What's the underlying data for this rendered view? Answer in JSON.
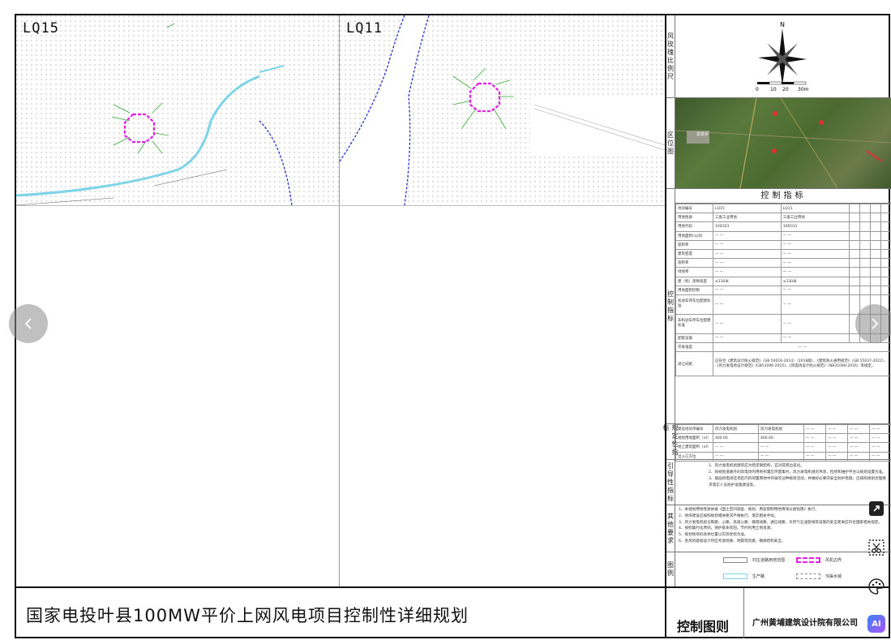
{
  "panels": {
    "left_label": "LQ15",
    "right_label": "LQ11"
  },
  "right_column": {
    "sections": {
      "compass": "风玫瑰比例尺",
      "location": "区位图",
      "control": "控制指标",
      "guide": "引导性指标",
      "other": "其他要求",
      "legend": "图例"
    },
    "scale_labels": [
      "0",
      "10",
      "20",
      "30m"
    ],
    "north": "N"
  },
  "control_table": {
    "title": "控制指标",
    "header": [
      "地块编号",
      "LQ15",
      "LQ11"
    ],
    "rows": [
      [
        "用地性质",
        "三类工业用地",
        "三类工业用地"
      ],
      [
        "用地代码",
        "100103",
        "100103"
      ],
      [
        "用地面积(公顷)",
        "— —",
        "— —"
      ],
      [
        "容积率",
        "— —",
        "— —"
      ],
      [
        "建筑密度",
        "— —",
        "— —"
      ],
      [
        "容积率",
        "— —",
        "— —"
      ],
      [
        "绿地率",
        "— —",
        "— —"
      ],
      [
        "建（构）筑物高度",
        "≤130米",
        "≤130米"
      ],
      [
        "用地面积控制",
        "— —",
        "— —"
      ],
      [
        "机动车停车位配建标准",
        "— —",
        "— —"
      ],
      [
        "非机动车停车位配建标准",
        "— —",
        "— —"
      ],
      [
        "配套设施",
        "— —",
        "— —"
      ],
      [
        "开发强度",
        "— —",
        ""
      ],
      [
        "退让间距",
        "应符合《建筑设计防火规范》（GB 50016-2014）（2018版）、《建筑防火通用规范》（GB 55037-2022）、《风力发电场设计规范》(GB51096-2015)、《风电场设计防火规范》（NB31089-2016）等规定。",
        ""
      ]
    ],
    "rows2": [
      [
        "建设地块单编号",
        "风力发电机组",
        "风力发电机组",
        "— —",
        "— —",
        "— —",
        "— —"
      ],
      [
        "规划用地面积（㎡）",
        "400.00",
        "400.00",
        "— —",
        "— —",
        "— —",
        "— —"
      ],
      [
        "地上建筑面积（㎡）",
        "— —",
        "— —",
        "— —",
        "— —",
        "— —",
        "— —"
      ],
      [
        "出入口方位",
        "— —",
        "— —",
        "— —",
        "— —",
        "— —",
        "— —"
      ]
    ]
  },
  "guide_text": [
    "1、风力发电机组建筑应为稳定钢结构，宜对其周边美化。",
    "2、除规划道路外的风电场内用地布置应尽量集约，风力发电机组的吊装、检修和维护平台以规划设置为准。",
    "3、鼓励风电场在场区内的闲置用地中开展农业种植等活动，并做好必要的安全防护措施；应按照规划合理要求落实人员防护设施建设等。"
  ],
  "other_text": [
    "1、本规划用地性质依据《国土空间调查、规划、用途管制用地用海分类指南》执行。",
    "2、地块建设应按照规划相关要求严格执行，落实相关手续。",
    "3、风力发电机组与铁路、公路、高速公路、输电线路、通信线路、天然气石油管线等设施的安全距离应符合国家相关规定。",
    "4、按照集约化原则，保护基本农田，节约利用土地资源。",
    "5、规划地块的具体位置以实际坐标为准。",
    "6、各风机基础设计时应考虑地质、地震等因素，确保结构安全。"
  ],
  "legend": [
    {
      "label": "村庄道路用地范围",
      "style": "solid-gray"
    },
    {
      "label": "风机边界",
      "style": "dashed-magenta"
    },
    {
      "label": "生产路",
      "style": "solid-cyan"
    },
    {
      "label": "沟渠水域",
      "style": "dashed-gray"
    }
  ],
  "title_bar": {
    "title": "国家电投叶县100MW平价上网风电项目控制性详细规划",
    "subtitle": "控制图则",
    "organization": "广州黄埔建筑设计院有限公司"
  },
  "location_map": {
    "town_label": "龙泉乡"
  },
  "colors": {
    "turbine": "#e61ee6",
    "road": "#7dd3e8",
    "boundary": "#2233cc",
    "green": "#33aa33"
  }
}
